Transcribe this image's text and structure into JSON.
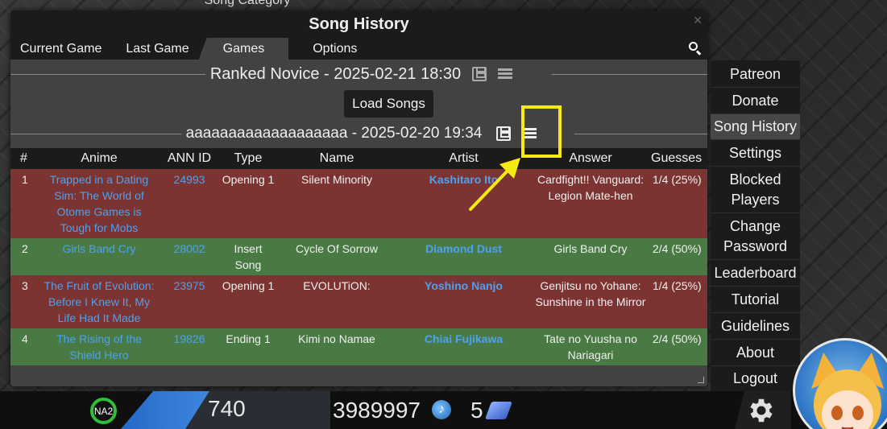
{
  "background": {
    "top_label": "Song Category"
  },
  "modal": {
    "title": "Song History",
    "tabs": [
      "Current Game",
      "Last Game",
      "Games",
      "Options"
    ],
    "active_tab": "Games",
    "games": [
      {
        "title": "Ranked Novice - 2025-02-21 18:30"
      },
      {
        "title": "aaaaaaaaaaaaaaaaaaa - 2025-02-20 19:34"
      }
    ],
    "load_button": "Load Songs",
    "table": {
      "headers": [
        "#",
        "Anime",
        "ANN ID",
        "Type",
        "Name",
        "Artist",
        "Answer",
        "Guesses"
      ],
      "rows": [
        {
          "num": "1",
          "anime": "Trapped in a Dating Sim: The World of Otome Games is Tough for Mobs",
          "ann_id": "24993",
          "type": "Opening 1",
          "name": "Silent Minority",
          "artist": "Kashitaro Ito",
          "answer": "Cardfight!! Vanguard: Legion Mate-hen",
          "guesses": "1/4 (25%)",
          "result": "wrong"
        },
        {
          "num": "2",
          "anime": "Girls Band Cry",
          "ann_id": "28002",
          "type": "Insert Song",
          "name": "Cycle Of Sorrow",
          "artist": "Diamond Dust",
          "answer": "Girls Band Cry",
          "guesses": "2/4 (50%)",
          "result": "right"
        },
        {
          "num": "3",
          "anime": "The Fruit of Evolution: Before I Knew It, My Life Had It Made",
          "ann_id": "23975",
          "type": "Opening 1",
          "name": "EVOLUTiON:",
          "artist": "Yoshino Nanjo",
          "answer": "Genjitsu no Yohane: Sunshine in the Mirror",
          "guesses": "1/4 (25%)",
          "result": "wrong"
        },
        {
          "num": "4",
          "anime": "The Rising of the Shield Hero",
          "ann_id": "19826",
          "type": "Ending 1",
          "name": "Kimi no Namae",
          "artist": "Chiai Fujikawa",
          "answer": "Tate no Yuusha no Nariagari",
          "guesses": "2/4 (50%)",
          "result": "right"
        }
      ]
    }
  },
  "side_menu": {
    "items": [
      "Patreon",
      "Donate",
      "Song History",
      "Settings",
      "Blocked Players",
      "Change Password",
      "Leaderboard",
      "Tutorial",
      "Guidelines",
      "About",
      "Logout"
    ],
    "active": "Song History"
  },
  "bottom_bar": {
    "level_badge": "NA2",
    "level": "740",
    "notes": "3989997",
    "tickets": "5"
  },
  "colors": {
    "wrong_row": "#7b3431",
    "right_row": "#4a7a43",
    "link": "#4ea1ef",
    "highlight": "#f5ea14"
  },
  "icons": [
    "search-icon",
    "save-icon",
    "menu-icon",
    "close-icon",
    "note-icon",
    "ticket-icon",
    "gear-icon"
  ]
}
